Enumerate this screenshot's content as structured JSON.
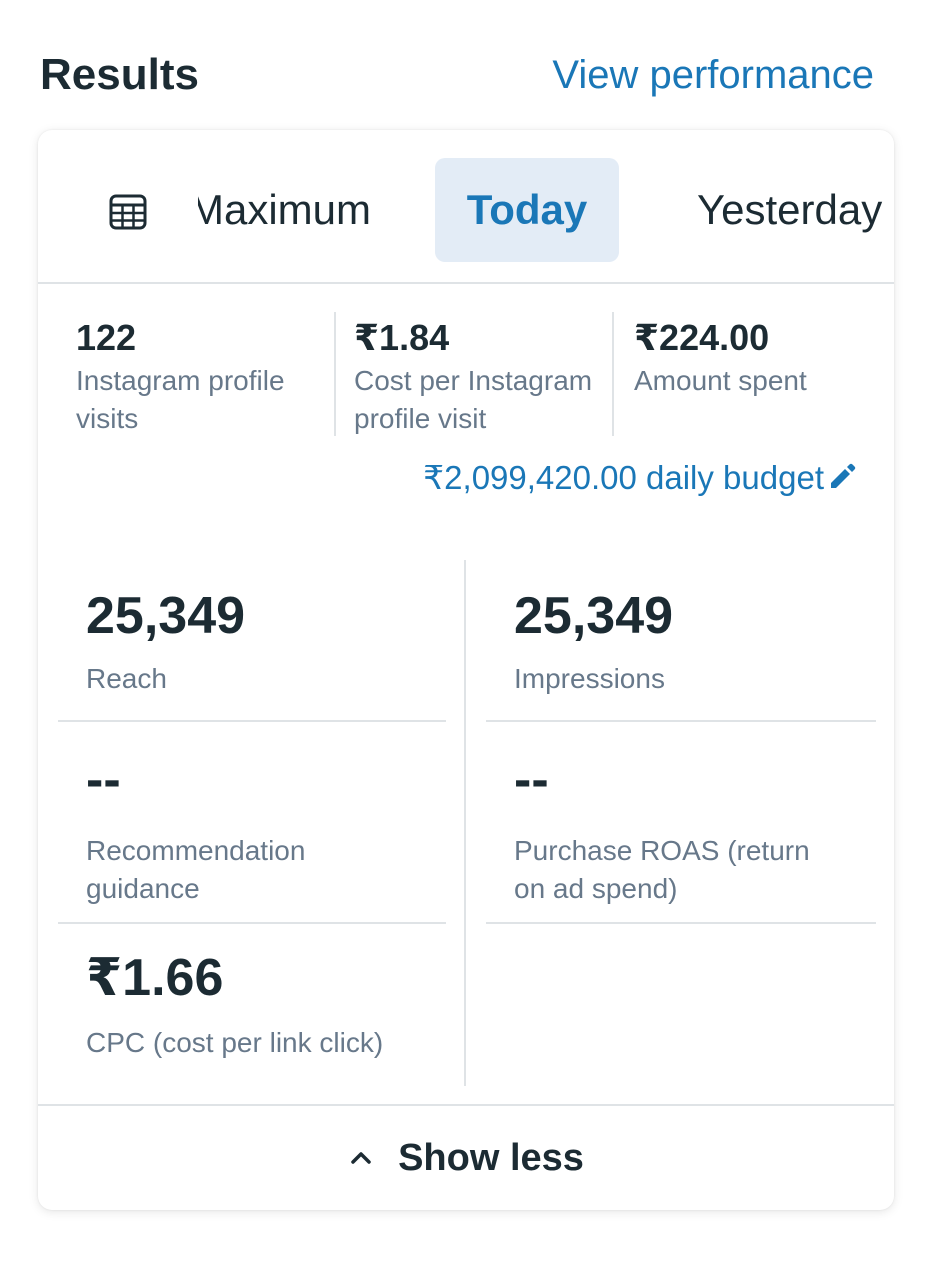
{
  "header": {
    "title": "Results",
    "view_link": "View performance"
  },
  "tabs": {
    "calendar_icon": "calendar-grid-icon",
    "items": [
      {
        "label": "Maximum",
        "selected": false
      },
      {
        "label": "Today",
        "selected": true
      },
      {
        "label": "Yesterday",
        "selected": false
      }
    ]
  },
  "summary": [
    {
      "value": "122",
      "label": "Instagram profile visits"
    },
    {
      "value": "₹1.84",
      "label": "Cost per Instagram profile visit"
    },
    {
      "value": "₹224.00",
      "label": "Amount spent"
    }
  ],
  "budget": {
    "text": "₹2,099,420.00 daily budget",
    "icon": "pencil-edit-icon"
  },
  "metrics": [
    {
      "value": "25,349",
      "label": "Reach"
    },
    {
      "value": "25,349",
      "label": "Impressions"
    },
    {
      "value": "--",
      "label": "Recommendation guidance"
    },
    {
      "value": "--",
      "label": "Purchase ROAS (return on ad spend)"
    },
    {
      "value": "₹1.66",
      "label": "CPC (cost per link click)"
    }
  ],
  "footer": {
    "label": "Show less",
    "icon": "chevron-up-icon"
  },
  "colors": {
    "accent": "#1a77b7",
    "text": "#1c2b33",
    "muted": "#67788a",
    "selected_tab_bg": "#e3ecf6",
    "divider": "#dfe3e6"
  }
}
